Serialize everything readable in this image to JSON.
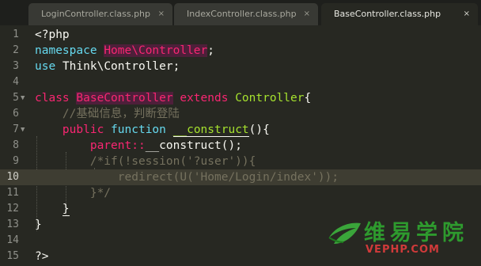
{
  "tabs": [
    {
      "label": "LoginController.class.php",
      "close": "×",
      "active": false
    },
    {
      "label": "IndexController.class.php",
      "close": "×",
      "active": false
    },
    {
      "label": "BaseController.class.php",
      "close": "×",
      "active": true
    }
  ],
  "editor": {
    "highlighted_line": 10,
    "line_numbers": [
      "1",
      "2",
      "3",
      "4",
      "5",
      "6",
      "7",
      "8",
      "9",
      "10",
      "11",
      "12",
      "13",
      "14",
      "15"
    ],
    "lines": {
      "l1": {
        "open_tag": "<?php"
      },
      "l2": {
        "kw": "namespace",
        "name": "Home\\Controller",
        "semi": ";"
      },
      "l3": {
        "kw": "use",
        "name": "Think\\Controller;"
      },
      "l5": {
        "kw": "class",
        "name": "BaseController",
        "kw2": "extends",
        "parent": "Controller",
        "brace": "{"
      },
      "l6": {
        "comment": "//基础信息，判断登陆"
      },
      "l7": {
        "kw1": "public",
        "kw2": "function",
        "fn": "__construct",
        "rest": "(){"
      },
      "l8": {
        "kw": "parent",
        "op": "::",
        "rest": "__construct();"
      },
      "l9": {
        "comment": "/*if(!session('?user')){"
      },
      "l10": {
        "comment": "redirect(U('Home/Login/index'));"
      },
      "l11": {
        "comment": "}*/"
      },
      "l12": {
        "brace": "}"
      },
      "l13": {
        "brace": "}"
      },
      "l15": {
        "close_tag": "?>"
      }
    }
  },
  "watermark": {
    "title": "维易学院",
    "subtitle": "VEPHP.COM"
  },
  "colors": {
    "background": "#272822",
    "keyword": "#66d9ef",
    "storage": "#f92672",
    "function": "#a6e22e",
    "comment": "#75715e"
  }
}
